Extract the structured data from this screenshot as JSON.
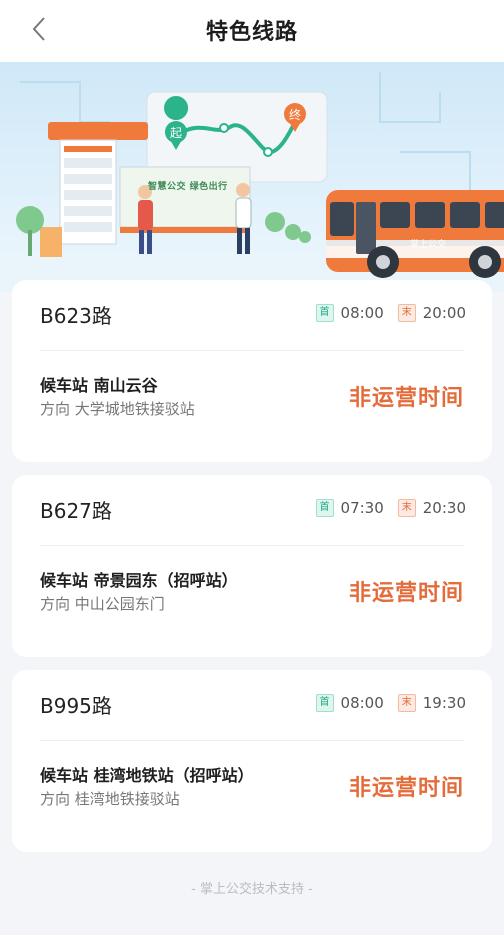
{
  "header": {
    "title": "特色线路"
  },
  "banner": {
    "slogan": "智慧公交 绿色出行",
    "bus_label": "掌上公交",
    "start_marker": "起",
    "end_marker": "终",
    "colors": {
      "sky": "#dff0fb",
      "accent_orange": "#f07a3c",
      "accent_green": "#2bb38a"
    }
  },
  "routes": [
    {
      "name": "B623路",
      "first_tag": "首",
      "first_time": "08:00",
      "last_tag": "末",
      "last_time": "20:00",
      "stop_prefix": "候车站",
      "stop": "南山云谷",
      "dir_prefix": "方向",
      "direction": "大学城地铁接驳站",
      "status": "非运营时间"
    },
    {
      "name": "B627路",
      "first_tag": "首",
      "first_time": "07:30",
      "last_tag": "末",
      "last_time": "20:30",
      "stop_prefix": "候车站",
      "stop": "帝景园东（招呼站）",
      "dir_prefix": "方向",
      "direction": "中山公园东门",
      "status": "非运营时间"
    },
    {
      "name": "B995路",
      "first_tag": "首",
      "first_time": "08:00",
      "last_tag": "末",
      "last_time": "19:30",
      "stop_prefix": "候车站",
      "stop": "桂湾地铁站（招呼站）",
      "dir_prefix": "方向",
      "direction": "桂湾地铁接驳站",
      "status": "非运营时间"
    }
  ],
  "footer": {
    "text": "- 掌上公交技术支持 -"
  }
}
